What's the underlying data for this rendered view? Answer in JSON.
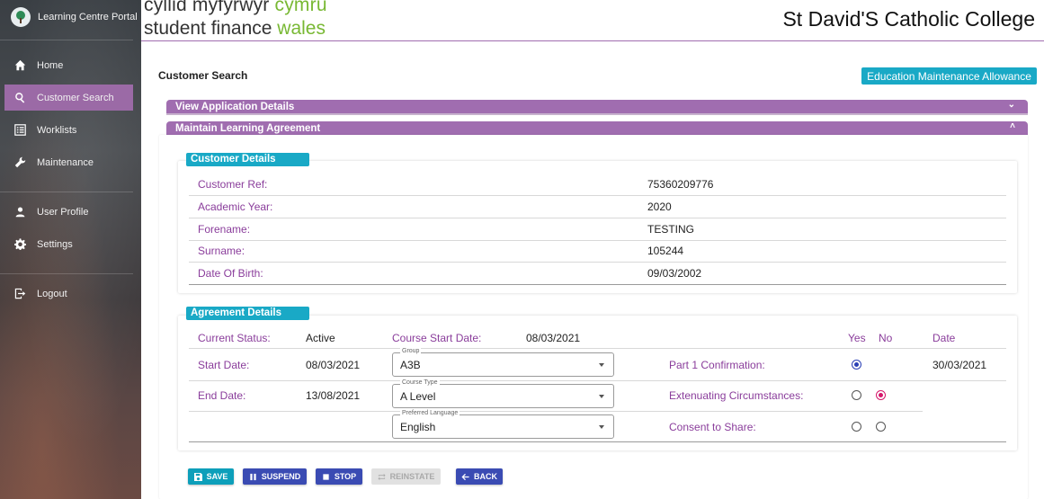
{
  "sidebar": {
    "portal_title": "Learning Centre Portal",
    "items": [
      {
        "label": "Home",
        "icon": "home-icon"
      },
      {
        "label": "Customer Search",
        "icon": "search-icon",
        "active": true
      },
      {
        "label": "Worklists",
        "icon": "list-icon"
      },
      {
        "label": "Maintenance",
        "icon": "wrench-icon"
      },
      {
        "label": "User Profile",
        "icon": "user-icon"
      },
      {
        "label": "Settings",
        "icon": "gear-icon"
      },
      {
        "label": "Logout",
        "icon": "logout-icon"
      }
    ]
  },
  "header": {
    "brand_line1_a": "cyllid myfyrwyr ",
    "brand_line1_b": "cymru",
    "brand_line2_a": "student finance ",
    "brand_line2_b": "wales",
    "college": "St David'S Catholic College"
  },
  "page": {
    "title": "Customer Search",
    "badge": "Education Maintenance Allowance"
  },
  "panels": {
    "view_application": "View Application Details",
    "maintain_agreement": "Maintain Learning Agreement"
  },
  "customer_details": {
    "heading": "Customer Details",
    "rows": [
      {
        "label": "Customer Ref:",
        "value": "75360209776"
      },
      {
        "label": "Academic Year:",
        "value": "2020"
      },
      {
        "label": "Forename:",
        "value": "TESTING"
      },
      {
        "label": "Surname:",
        "value": "105244"
      },
      {
        "label": "Date Of Birth:",
        "value": "09/03/2002"
      }
    ]
  },
  "agreement": {
    "heading": "Agreement Details",
    "current_status_label": "Current Status:",
    "current_status_value": "Active",
    "course_start_label": "Course Start Date:",
    "course_start_value": "08/03/2021",
    "start_date_label": "Start Date:",
    "start_date_value": "08/03/2021",
    "end_date_label": "End Date:",
    "end_date_value": "13/08/2021",
    "group": {
      "legend": "Group",
      "value": "A3B"
    },
    "course_type": {
      "legend": "Course Type",
      "value": "A Level"
    },
    "preferred_language": {
      "legend": "Preferred Language",
      "value": "English"
    },
    "col_yes": "Yes",
    "col_no": "No",
    "col_date": "Date",
    "part1_label": "Part 1 Confirmation:",
    "part1_date": "30/03/2021",
    "extenuating_label": "Extenuating Circumstances:",
    "consent_label": "Consent to Share:"
  },
  "actions": {
    "save": "SAVE",
    "suspend": "SUSPEND",
    "stop": "STOP",
    "reinstate": "REINSTATE",
    "back": "BACK"
  },
  "colors": {
    "accent_purple": "#a06db0",
    "label_purple": "#8a3d9b",
    "teal": "#19a9c6",
    "indigo": "#3a4bb3",
    "radio_blue": "#2a3fb5",
    "radio_red": "#d6166b"
  }
}
